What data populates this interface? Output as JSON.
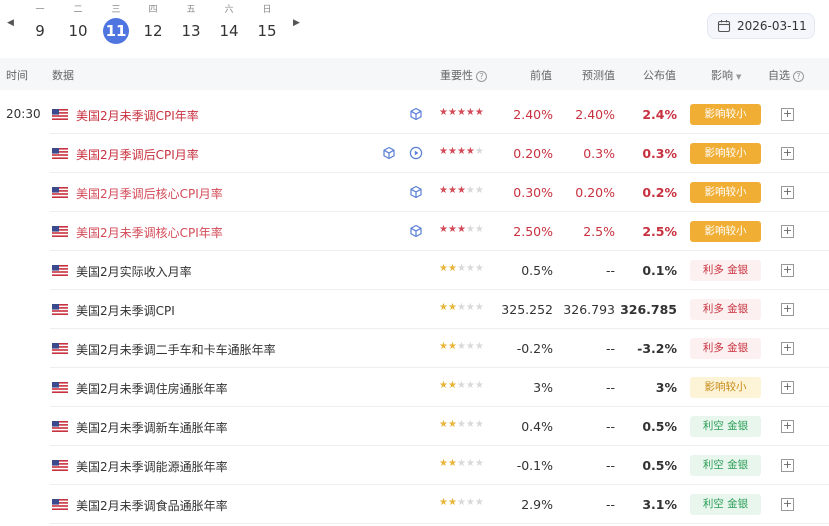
{
  "calendar": {
    "days": [
      {
        "weekday": "一",
        "day": "9"
      },
      {
        "weekday": "二",
        "day": "10"
      },
      {
        "weekday": "三",
        "day": "11"
      },
      {
        "weekday": "四",
        "day": "12"
      },
      {
        "weekday": "五",
        "day": "13"
      },
      {
        "weekday": "六",
        "day": "14"
      },
      {
        "weekday": "日",
        "day": "15"
      }
    ],
    "active_day": "11",
    "prev_arrow": "◀",
    "next_arrow": "▶",
    "selected_date": "2026-03-11"
  },
  "header": {
    "time": "时间",
    "data": "数据",
    "importance": "重要性",
    "previous": "前值",
    "forecast": "预测值",
    "actual": "公布值",
    "impact": "影响",
    "watchlist": "自选"
  },
  "colors": {
    "accent_blue": "#4f76e0",
    "red": "#c8313f",
    "gold_badge": "#f0ae35",
    "green": "#2a9d55"
  },
  "rows": [
    {
      "time": "20:30",
      "name": "美国2月未季调CPI年率",
      "stars": 5,
      "previous": "2.40%",
      "forecast": "2.40%",
      "actual": "2.4%",
      "impact": "影响较小",
      "icons": [
        "cube-icon"
      ]
    },
    {
      "time": "",
      "name": "美国2月季调后CPI月率",
      "stars": 4,
      "previous": "0.20%",
      "forecast": "0.3%",
      "actual": "0.3%",
      "impact": "影响较小",
      "icons": [
        "cube-icon",
        "play-icon"
      ]
    },
    {
      "time": "",
      "name": "美国2月季调后核心CPI月率",
      "stars": 3,
      "previous": "0.30%",
      "forecast": "0.20%",
      "actual": "0.2%",
      "impact": "影响较小",
      "icons": [
        "cube-icon"
      ]
    },
    {
      "time": "",
      "name": "美国2月未季调核心CPI年率",
      "stars": 3,
      "previous": "2.50%",
      "forecast": "2.5%",
      "actual": "2.5%",
      "impact": "影响较小",
      "icons": [
        "cube-icon"
      ]
    },
    {
      "time": "",
      "name": "美国2月实际收入月率",
      "stars": 2,
      "previous": "0.5%",
      "forecast": "--",
      "actual": "0.1%",
      "impact": "利多 金银",
      "icons": []
    },
    {
      "time": "",
      "name": "美国2月未季调CPI",
      "stars": 2,
      "previous": "325.252",
      "forecast": "326.793",
      "actual": "326.785",
      "impact": "利多 金银",
      "icons": []
    },
    {
      "time": "",
      "name": "美国2月未季调二手车和卡车通胀年率",
      "stars": 2,
      "previous": "-0.2%",
      "forecast": "--",
      "actual": "-3.2%",
      "impact": "利多 金银",
      "icons": []
    },
    {
      "time": "",
      "name": "美国2月未季调住房通胀年率",
      "stars": 2,
      "previous": "3%",
      "forecast": "--",
      "actual": "3%",
      "impact": "影响较小",
      "icons": []
    },
    {
      "time": "",
      "name": "美国2月未季调新车通胀年率",
      "stars": 2,
      "previous": "0.4%",
      "forecast": "--",
      "actual": "0.5%",
      "impact": "利空 金银",
      "icons": []
    },
    {
      "time": "",
      "name": "美国2月未季调能源通胀年率",
      "stars": 2,
      "previous": "-0.1%",
      "forecast": "--",
      "actual": "0.5%",
      "impact": "利空 金银",
      "icons": []
    },
    {
      "time": "",
      "name": "美国2月未季调食品通胀年率",
      "stars": 2,
      "previous": "2.9%",
      "forecast": "--",
      "actual": "3.1%",
      "impact": "利空 金银",
      "icons": []
    }
  ]
}
